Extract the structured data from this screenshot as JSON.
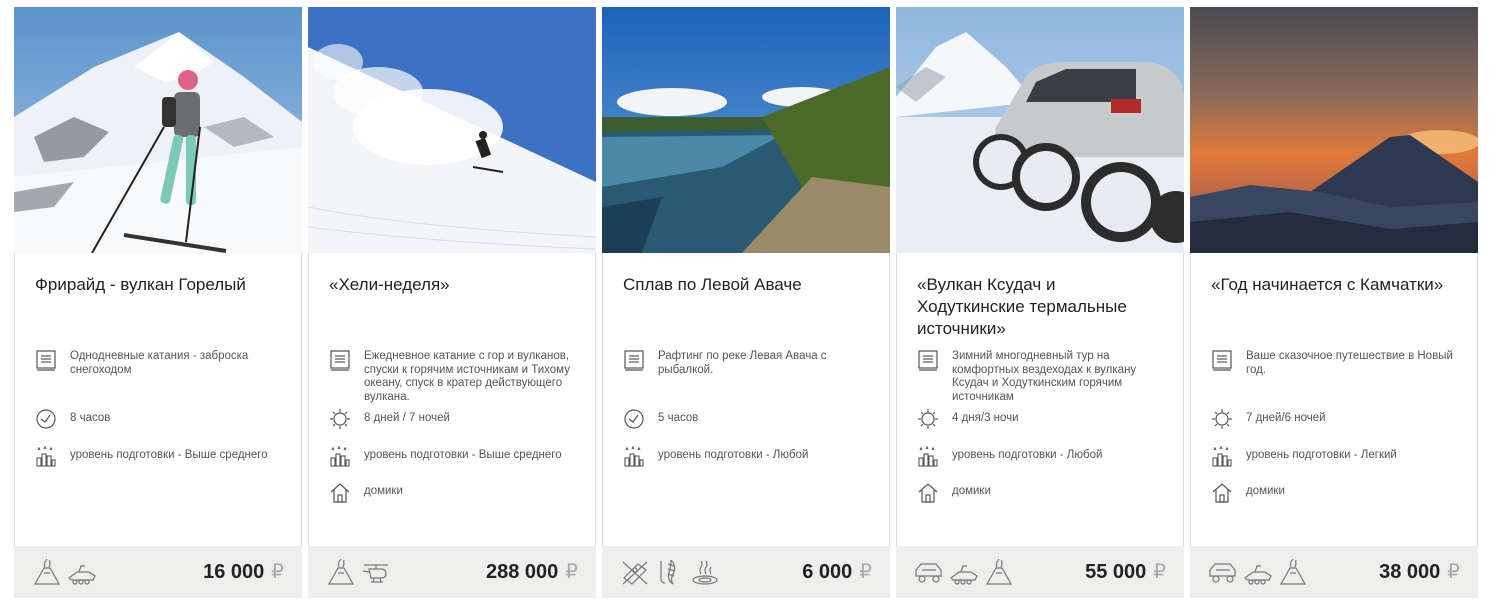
{
  "currency_symbol": "₽",
  "cards": [
    {
      "title": "Фрирайд - вулкан Горелый",
      "description": "Однодневные катания - заброска снегоходом",
      "duration": "8 часов",
      "level": "уровень подготовки - Выше среднего",
      "lodging": "",
      "price": "16 000",
      "photo": "skier-on-volcano",
      "footer_icons": [
        "volcano-icon",
        "snowmobile-icon"
      ]
    },
    {
      "title": "«Хели-неделя»",
      "description": "Ежедневное катание с гор и вулканов, спуски к горячим источникам и Тихому океану, спуск в кратер действующего вулкана.",
      "duration": "8 дней / 7 ночей",
      "level": "уровень подготовки - Выше среднего",
      "lodging": "домики",
      "price": "288 000",
      "photo": "freerider-powder-slope",
      "footer_icons": [
        "volcano-icon",
        "helicopter-icon"
      ]
    },
    {
      "title": "Сплав по Левой Аваче",
      "description": "Рафтинг по реке Левая Авача с рыбалкой.",
      "duration": "5 часов",
      "level": "уровень подготовки - Любой",
      "lodging": "",
      "price": "6 000",
      "photo": "river-landscape",
      "footer_icons": [
        "rafting-icon",
        "fishing-icon",
        "hot-spring-icon"
      ]
    },
    {
      "title": "«Вулкан Ксудач и Ходуткинские термальные источники»",
      "description": "Зимний многодневный тур на комфортных вездеходах к вулкану Ксудач и Ходуткинским горячим источникам",
      "duration": "4 дня/3 ночи",
      "level": "уровень подготовки - Любой",
      "lodging": "домики",
      "price": "55 000",
      "photo": "offroad-truck-in-snow",
      "footer_icons": [
        "offroad-car-icon",
        "snowmobile-icon",
        "volcano-icon"
      ]
    },
    {
      "title": "«Год начинается с Камчатки»",
      "description": "Ваше сказочное путешествие в Новый год.",
      "duration": "7 дней/6 ночей",
      "level": "уровень подготовки - Легкий",
      "lodging": "домики",
      "price": "38 000",
      "photo": "volcano-sunset",
      "footer_icons": [
        "offroad-car-icon",
        "snowmobile-icon",
        "volcano-icon"
      ]
    }
  ]
}
